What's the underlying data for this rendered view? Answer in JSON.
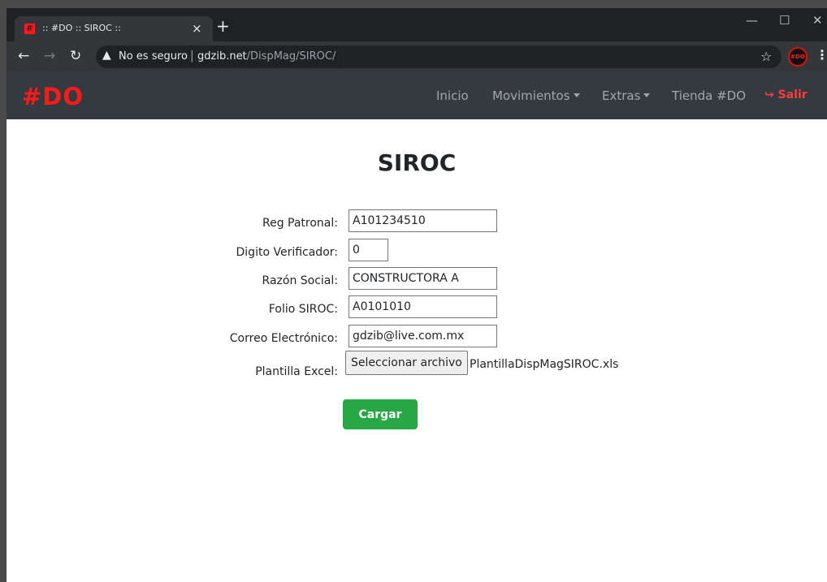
{
  "browser": {
    "tab_title": ":: #DO :: SIROC ::",
    "tab_close": "×",
    "new_tab": "+",
    "window_min": "—",
    "window_max": "☐",
    "window_close": "✕",
    "security_label": "No es seguro",
    "separator": "|",
    "url_host": "gdzib.net",
    "url_path": "/DispMag/SIROC/",
    "avatar_text": "#DO"
  },
  "navbar": {
    "brand": "#DO",
    "links": {
      "inicio": "Inicio",
      "movimientos": "Movimientos",
      "extras": "Extras",
      "tienda": "Tienda #DO",
      "salir": "Salir"
    }
  },
  "form": {
    "title": "SIROC",
    "reg_patronal": {
      "label": "Reg Patronal:",
      "value": "A101234510"
    },
    "digito": {
      "label": "Digito Verificador:",
      "value": "0"
    },
    "razon": {
      "label": "Razón Social:",
      "value": "CONSTRUCTORA A"
    },
    "folio": {
      "label": "Folio SIROC:",
      "value": "A0101010"
    },
    "correo": {
      "label": "Correo Electrónico:",
      "value": "gdzib@live.com.mx"
    },
    "plantilla": {
      "label": "Plantilla Excel:",
      "button": "Seleccionar archivo",
      "filename": "PlantillaDispMagSIROC.xls"
    },
    "submit": "Cargar"
  },
  "colors": {
    "brand": "#ff1a1a",
    "navbar": "#343a40",
    "submit": "#28a745"
  }
}
